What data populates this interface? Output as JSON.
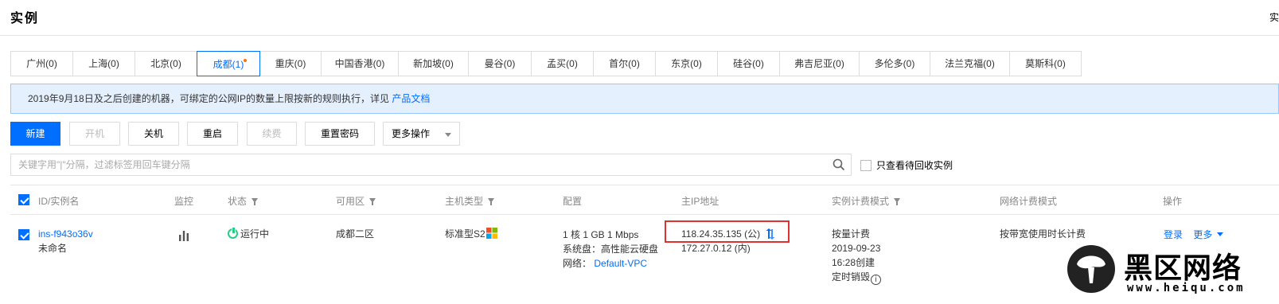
{
  "header": {
    "title": "实例",
    "right_text": "实"
  },
  "regions": [
    {
      "label": "广州(0)",
      "active": false
    },
    {
      "label": "上海(0)",
      "active": false
    },
    {
      "label": "北京(0)",
      "active": false
    },
    {
      "label": "成都(1)",
      "active": true,
      "dot": true
    },
    {
      "label": "重庆(0)",
      "active": false
    },
    {
      "label": "中国香港(0)",
      "active": false
    },
    {
      "label": "新加坡(0)",
      "active": false
    },
    {
      "label": "曼谷(0)",
      "active": false
    },
    {
      "label": "孟买(0)",
      "active": false
    },
    {
      "label": "首尔(0)",
      "active": false
    },
    {
      "label": "东京(0)",
      "active": false
    },
    {
      "label": "硅谷(0)",
      "active": false
    },
    {
      "label": "弗吉尼亚(0)",
      "active": false
    },
    {
      "label": "多伦多(0)",
      "active": false
    },
    {
      "label": "法兰克福(0)",
      "active": false
    },
    {
      "label": "莫斯科(0)",
      "active": false
    }
  ],
  "notice": {
    "text": "2019年9月18日及之后创建的机器，可绑定的公网IP的数量上限按新的规则执行，详见 ",
    "link": "产品文档"
  },
  "toolbar": {
    "new": "新建",
    "start": "开机",
    "shutdown": "关机",
    "restart": "重启",
    "renew": "续费",
    "reset_password": "重置密码",
    "more_actions": "更多操作"
  },
  "search": {
    "placeholder": "关键字用\"|\"分隔，过滤标签用回车键分隔",
    "value": ""
  },
  "recycle_filter": {
    "label": "只查看待回收实例",
    "checked": false
  },
  "table": {
    "columns": {
      "id": "ID/实例名",
      "monitor": "监控",
      "status": "状态",
      "zone": "可用区",
      "type": "主机类型",
      "config": "配置",
      "ip": "主IP地址",
      "billing": "实例计费模式",
      "net_billing": "网络计费模式",
      "ops": "操作"
    },
    "rows": [
      {
        "checked": true,
        "id": "ins-f943o36v",
        "name": "未命名",
        "status": "运行中",
        "zone": "成都二区",
        "type": "标准型S2",
        "config_line1": "1 核 1 GB 1 Mbps",
        "config_line2": "系统盘：高性能云硬盘",
        "config_net_label": "网络：",
        "config_net_link": "Default-VPC",
        "public_ip": "118.24.35.135 (公)",
        "private_ip": "172.27.0.12 (内)",
        "billing_mode": "按量计费",
        "created_date": "2019-09-23",
        "created_time": "16:28创建",
        "scheduled_destroy": "定时销毁",
        "net_billing": "按带宽使用时长计费",
        "op_login": "登录",
        "op_more": "更多"
      }
    ]
  },
  "watermark": {
    "title": "黑区网络",
    "url": "www.heiqu.com"
  },
  "colors": {
    "primary": "#006eff",
    "notice_bg": "#e5f0ff",
    "running": "#29cc85",
    "highlight": "#e03131",
    "dot": "#ff7200"
  }
}
